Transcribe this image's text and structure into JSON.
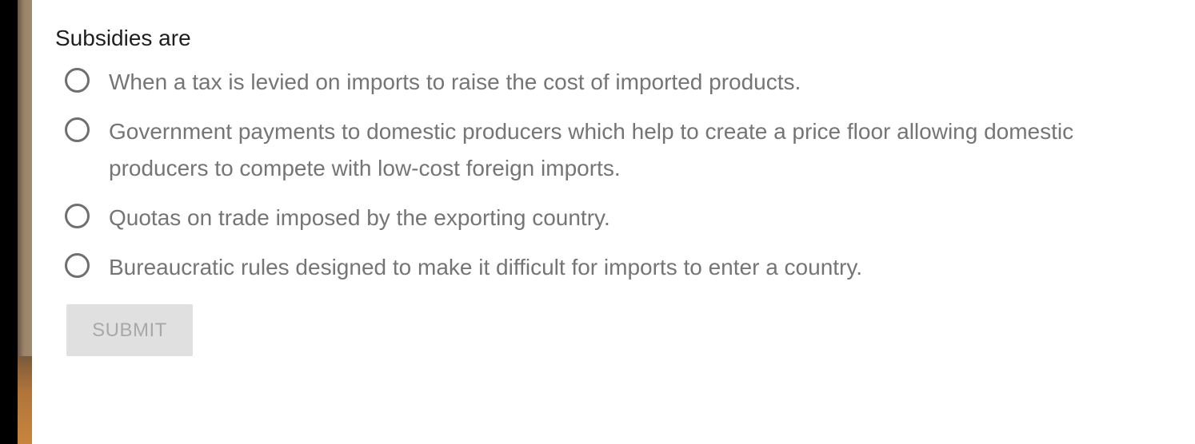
{
  "question": {
    "text": "Subsidies are"
  },
  "options": [
    {
      "label": "When a tax is levied on imports to raise the cost of imported products."
    },
    {
      "label": "Government payments to domestic producers which help to create a price floor allowing domestic producers to compete with low-cost foreign imports."
    },
    {
      "label": "Quotas on trade imposed by the exporting country."
    },
    {
      "label": "Bureaucratic rules designed to make it difficult for imports to enter a country."
    }
  ],
  "submit": {
    "label": "SUBMIT",
    "state": "disabled"
  },
  "colors": {
    "question_text": "#1f1f1f",
    "option_text": "#757575",
    "radio_border": "#6f6f6f",
    "submit_bg": "#e0e0e0",
    "submit_text": "#a8a8a8"
  }
}
